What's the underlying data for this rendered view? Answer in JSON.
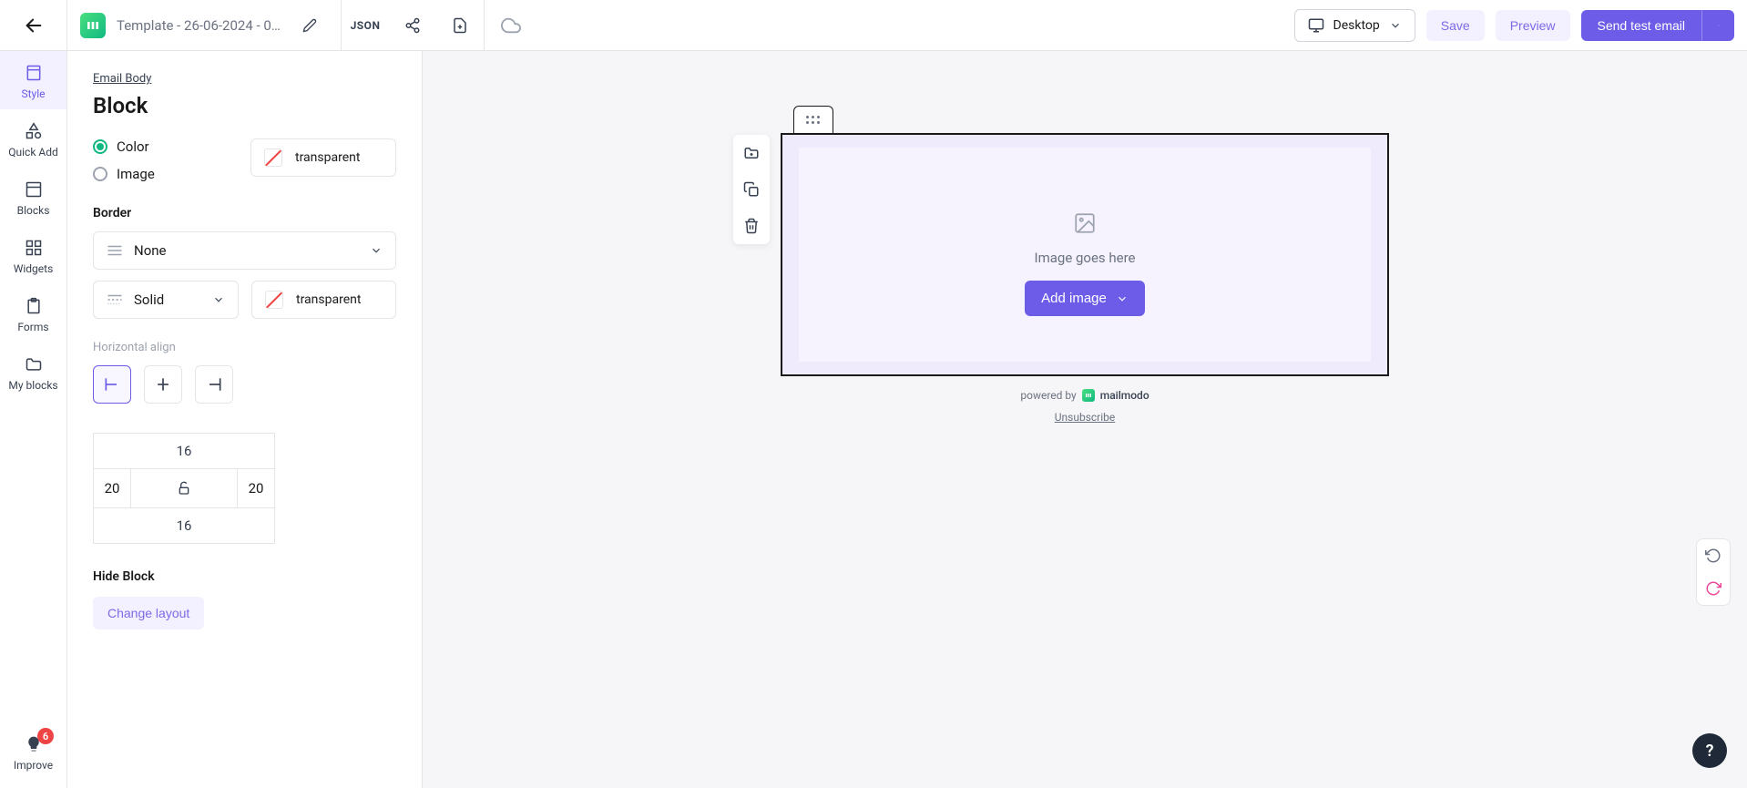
{
  "header": {
    "title": "Template - 26-06-2024 - 0...",
    "json_label": "JSON",
    "device": "Desktop",
    "save": "Save",
    "preview": "Preview",
    "send": "Send test email"
  },
  "vnav": {
    "style": "Style",
    "quick_add": "Quick Add",
    "blocks": "Blocks",
    "widgets": "Widgets",
    "forms": "Forms",
    "my_blocks": "My blocks",
    "improve": "Improve",
    "improve_count": "6"
  },
  "panel": {
    "breadcrumb": "Email Body",
    "title": "Block",
    "bg_color_label": "Color",
    "bg_image_label": "Image",
    "bg_value": "transparent",
    "border_label": "Border",
    "border_style_none": "None",
    "border_style_solid": "Solid",
    "border_color": "transparent",
    "halign_label": "Horizontal align",
    "padding": {
      "top": "16",
      "right": "20",
      "bottom": "16",
      "left": "20"
    },
    "hide_label": "Hide Block",
    "change_layout": "Change layout"
  },
  "canvas": {
    "placeholder_text": "Image goes here",
    "add_image": "Add image",
    "powered_by": "powered by",
    "brand": "mailmodo",
    "unsubscribe": "Unsubscribe"
  },
  "help": "?"
}
